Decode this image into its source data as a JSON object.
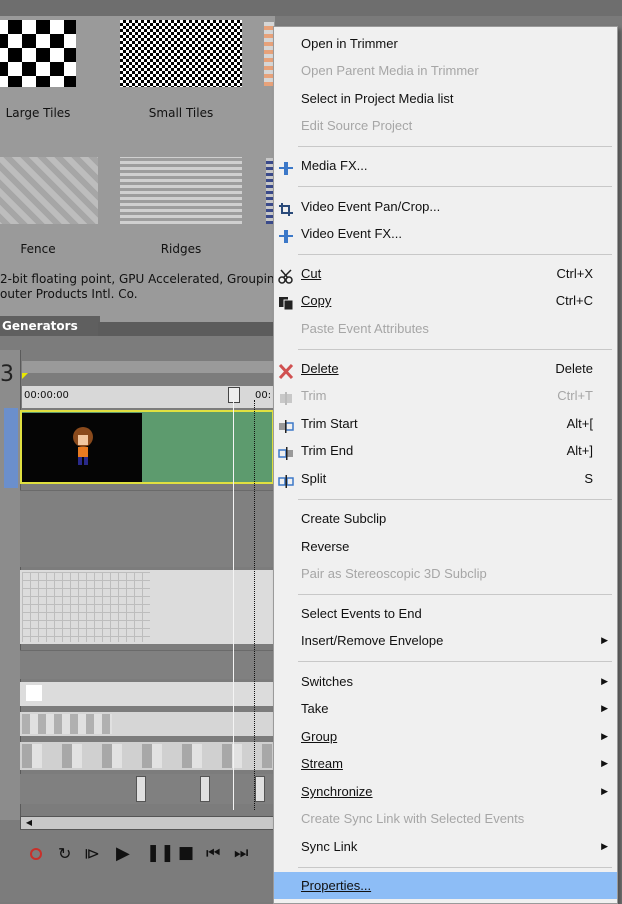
{
  "generators": {
    "large_tiles": "Large Tiles",
    "small_tiles": "Small Tiles",
    "fence": "Fence",
    "ridges": "Ridges",
    "info_line1": "2-bit floating point, GPU Accelerated, Groupin",
    "info_line2": "outer Products Intl. Co.",
    "tab_label": "Generators"
  },
  "timeline": {
    "track_number": "3",
    "timecode": "00:00:00",
    "timecode2": "00:"
  },
  "menu": {
    "open_in_trimmer": "Open in Trimmer",
    "open_parent_media": "Open Parent Media in Trimmer",
    "select_in_project_media": "Select in Project Media list",
    "edit_source_project": "Edit Source Project",
    "media_fx": "Media FX...",
    "pan_crop": "Video Event Pan/Crop...",
    "video_event_fx": "Video Event FX...",
    "cut": "Cut",
    "cut_key": "Ctrl+X",
    "copy": "Copy",
    "copy_key": "Ctrl+C",
    "paste_attrs": "Paste Event Attributes",
    "delete": "Delete",
    "delete_key": "Delete",
    "trim": "Trim",
    "trim_key": "Ctrl+T",
    "trim_start": "Trim Start",
    "trim_start_key": "Alt+[",
    "trim_end": "Trim End",
    "trim_end_key": "Alt+]",
    "split": "Split",
    "split_key": "S",
    "create_subclip": "Create Subclip",
    "reverse": "Reverse",
    "pair_stereo": "Pair as Stereoscopic 3D Subclip",
    "select_events_end": "Select Events to End",
    "insert_envelope": "Insert/Remove Envelope",
    "switches": "Switches",
    "take": "Take",
    "group": "Group",
    "stream": "Stream",
    "synchronize": "Synchronize",
    "create_sync_link": "Create Sync Link with Selected Events",
    "sync_link": "Sync Link",
    "properties": "Properties..."
  }
}
